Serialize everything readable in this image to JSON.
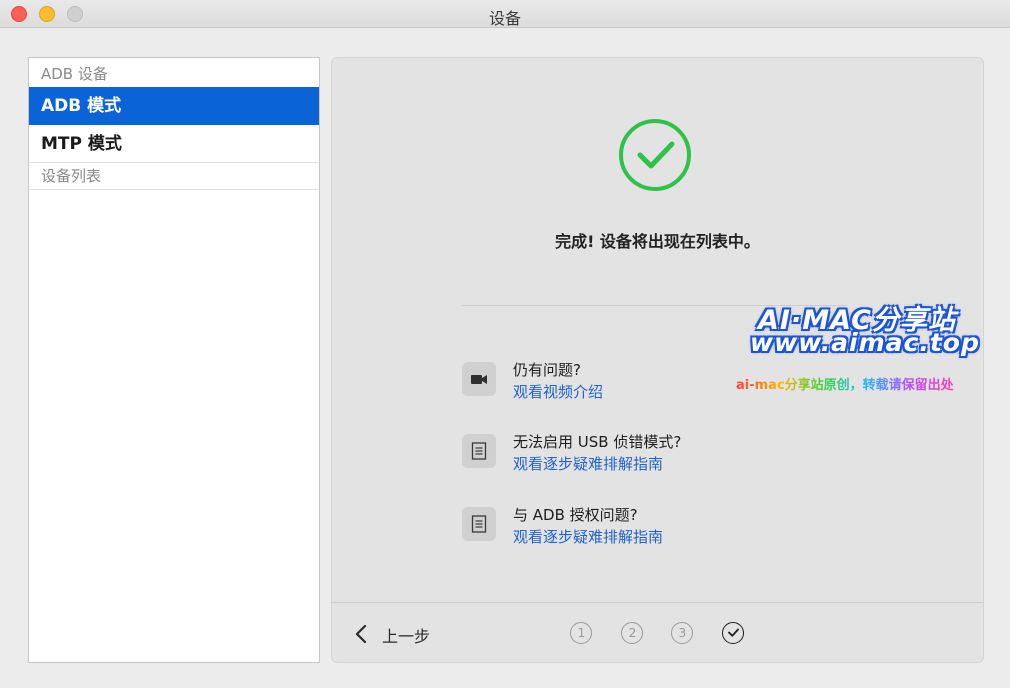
{
  "window": {
    "title": "设备"
  },
  "sidebar": {
    "header": "ADB 设备",
    "items": [
      {
        "label": "ADB 模式",
        "selected": true
      },
      {
        "label": "MTP 模式",
        "selected": false
      }
    ],
    "section": "设备列表"
  },
  "panel": {
    "status_text": "完成! 设备将出现在列表中。",
    "help": [
      {
        "question": "仍有问题?",
        "link": "观看视频介绍",
        "icon": "video-camera-icon"
      },
      {
        "question": "无法启用 USB 侦错模式?",
        "link": "观看逐步疑难排解指南",
        "icon": "document-icon"
      },
      {
        "question": "与 ADB 授权问题?",
        "link": "观看逐步疑难排解指南",
        "icon": "document-icon"
      }
    ],
    "footer": {
      "back_label": "上一步",
      "steps": [
        "①",
        "②",
        "③"
      ],
      "current_step": 4
    }
  },
  "watermark": {
    "line1": "AI·MAC分享站",
    "line2": "www.aimac.top",
    "line3": "ai-mac分享站原创，转载请保留出处"
  },
  "colors": {
    "selection": "#0a64d8",
    "success": "#2fc24a",
    "link": "#1f63c8"
  }
}
